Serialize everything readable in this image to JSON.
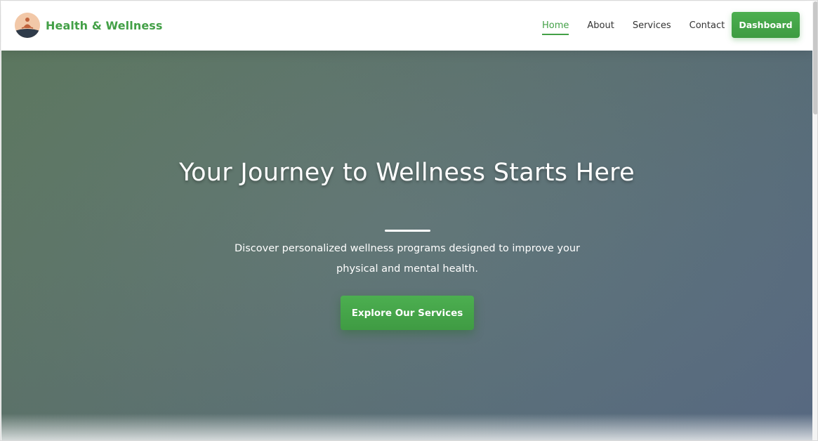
{
  "header": {
    "brand": "Health & Wellness",
    "logo_icon": "meditation-logo-icon",
    "nav": [
      {
        "label": "Home",
        "active": true
      },
      {
        "label": "About",
        "active": false
      },
      {
        "label": "Services",
        "active": false
      },
      {
        "label": "Contact",
        "active": false
      }
    ],
    "dashboard_label": "Dashboard"
  },
  "hero": {
    "title": "Your Journey to Wellness Starts Here",
    "subtitle": "Discover personalized wellness programs designed to improve your physical and mental health.",
    "cta_label": "Explore Our Services"
  },
  "colors": {
    "accent": "#43a047",
    "hero_overlay_start": "#5f7b62",
    "hero_overlay_end": "#5a6c86",
    "text_on_hero": "#ffffff"
  }
}
